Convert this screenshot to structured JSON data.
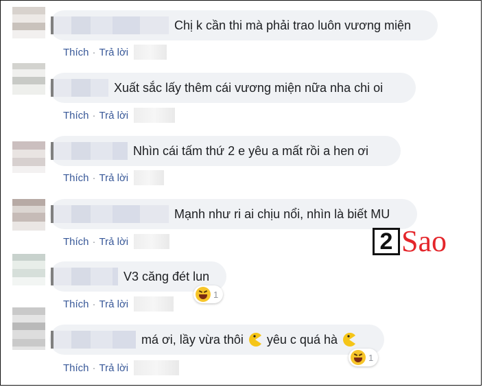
{
  "comments": [
    {
      "text": "Chị k cần thi mà phải trao luôn vương miện",
      "like": "Thích",
      "reply": "Trả lời"
    },
    {
      "text": "Xuất sắc lấy thêm cái vương miện nữa nha chi oi",
      "like": "Thích",
      "reply": "Trả lời"
    },
    {
      "text": "Nhìn cái tấm thứ 2 e yêu a mất rồi a hen ơi",
      "like": "Thích",
      "reply": "Trả lời"
    },
    {
      "text": "Mạnh như ri ai chịu nổi, nhìn là biết MU",
      "like": "Thích",
      "reply": "Trả lời"
    },
    {
      "text": "V3 căng đét lun",
      "like": "Thích",
      "reply": "Trả lời",
      "reaction": {
        "emoji": "laughing-emoji",
        "count": "1"
      }
    },
    {
      "text_a": "má ơi, lầy vừa thôi",
      "text_b": "yêu c quá hà",
      "like": "Thích",
      "reply": "Trả lời",
      "reaction": {
        "emoji": "laughing-emoji",
        "count": "1"
      }
    }
  ],
  "watermark": {
    "digit": "2",
    "word": "Sao",
    "color": "#e4262b"
  },
  "colors": {
    "link": "#385898",
    "bubble": "#f0f2f5",
    "text": "#1c1e21"
  }
}
